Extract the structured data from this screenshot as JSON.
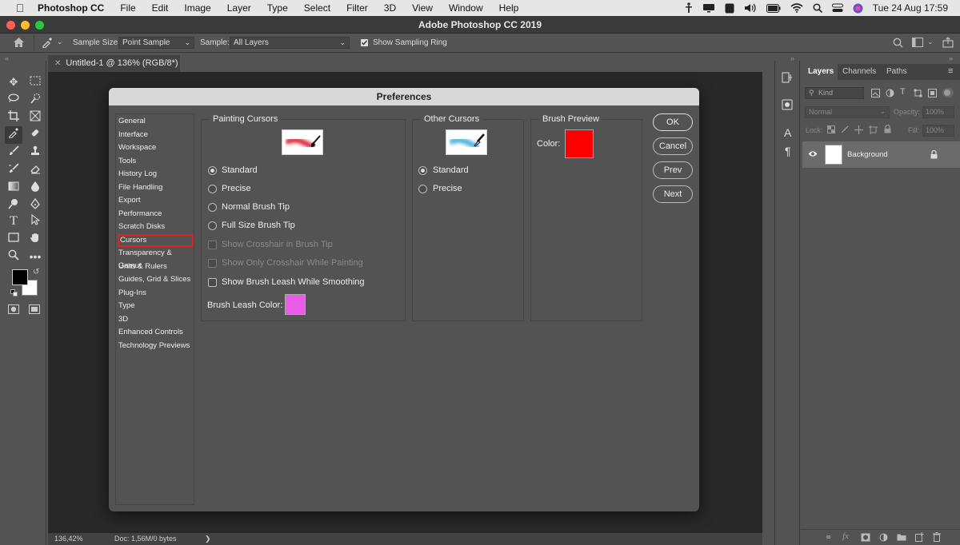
{
  "menubar": {
    "app_name": "Photoshop CC",
    "items": [
      "File",
      "Edit",
      "Image",
      "Layer",
      "Type",
      "Select",
      "Filter",
      "3D",
      "View",
      "Window",
      "Help"
    ],
    "datetime": "Tue 24 Aug  17:59"
  },
  "window": {
    "title": "Adobe Photoshop CC 2019"
  },
  "options_bar": {
    "sample_size_label": "Sample Size:",
    "sample_size_value": "Point Sample",
    "sample_label": "Sample:",
    "sample_value": "All Layers",
    "show_sampling_ring": "Show Sampling Ring"
  },
  "document": {
    "tab_label": "Untitled-1 @ 136% (RGB/8*)",
    "zoom": "136,42%",
    "doc_info": "Doc: 1,56M/0 bytes"
  },
  "layers_panel": {
    "tabs": [
      "Layers",
      "Channels",
      "Paths"
    ],
    "filter_kind": "Kind",
    "blend_mode": "Normal",
    "opacity_label": "Opacity:",
    "opacity_value": "100%",
    "lock_label": "Lock:",
    "fill_label": "Fill:",
    "fill_value": "100%",
    "layer_name": "Background"
  },
  "preferences": {
    "title": "Preferences",
    "categories": [
      "General",
      "Interface",
      "Workspace",
      "Tools",
      "History Log",
      "File Handling",
      "Export",
      "Performance",
      "Scratch Disks",
      "Cursors",
      "Transparency & Gamut",
      "Units & Rulers",
      "Guides, Grid & Slices",
      "Plug-Ins",
      "Type",
      "3D",
      "Enhanced Controls",
      "Technology Previews"
    ],
    "active_category": "Cursors",
    "painting_cursors": {
      "title": "Painting Cursors",
      "options": [
        "Standard",
        "Precise",
        "Normal Brush Tip",
        "Full Size Brush Tip"
      ],
      "selected": "Standard",
      "disabled_checks": [
        "Show Crosshair in Brush Tip",
        "Show Only Crosshair While Painting"
      ],
      "leash_check": "Show Brush Leash While Smoothing",
      "leash_color_label": "Brush Leash Color:",
      "leash_color": "#e85ce8"
    },
    "other_cursors": {
      "title": "Other Cursors",
      "options": [
        "Standard",
        "Precise"
      ],
      "selected": "Standard"
    },
    "brush_preview": {
      "title": "Brush Preview",
      "color_label": "Color:",
      "color": "#ff0000"
    },
    "buttons": {
      "ok": "OK",
      "cancel": "Cancel",
      "prev": "Prev",
      "next": "Next"
    }
  }
}
